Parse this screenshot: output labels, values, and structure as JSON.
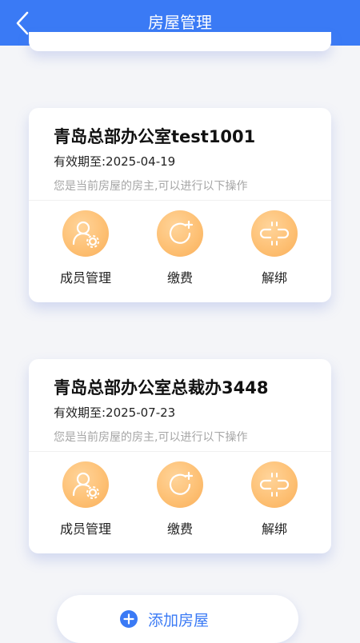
{
  "header": {
    "title": "房屋管理",
    "back_icon": "chevron-left-icon",
    "background_color": "#3a7af5"
  },
  "houses": [
    {
      "name": "青岛总部办公室test1001",
      "expiry": "有效期至:2025-04-19",
      "hint": "您是当前房屋的房主,可以进行以下操作",
      "actions": [
        {
          "label": "成员管理",
          "icon": "user-settings-icon"
        },
        {
          "label": "缴费",
          "icon": "refresh-add-icon"
        },
        {
          "label": "解绑",
          "icon": "unlink-icon"
        }
      ]
    },
    {
      "name": "青岛总部办公室总裁办3448",
      "expiry": "有效期至:2025-07-23",
      "hint": "您是当前房屋的房主,可以进行以下操作",
      "actions": [
        {
          "label": "成员管理",
          "icon": "user-settings-icon"
        },
        {
          "label": "缴费",
          "icon": "refresh-add-icon"
        },
        {
          "label": "解绑",
          "icon": "unlink-icon"
        }
      ]
    }
  ],
  "add_house": {
    "label": "添加房屋",
    "icon": "plus-circle-icon"
  },
  "colors": {
    "accent": "#3a7af5",
    "action_orange": "#fdbf72"
  }
}
